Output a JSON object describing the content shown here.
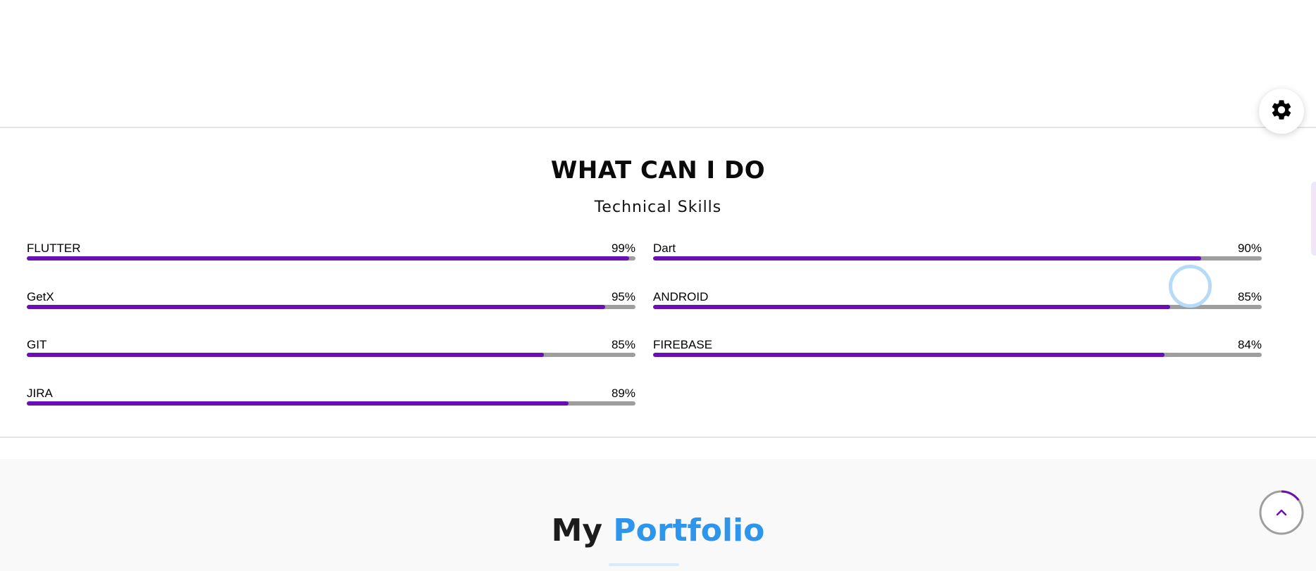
{
  "settings": {
    "icon": "gear-icon"
  },
  "skills": {
    "title": "WHAT CAN I DO",
    "subtitle": "Technical Skills",
    "colors": {
      "fill": "#6a0fb1",
      "track": "#9e9e9e"
    },
    "items": [
      {
        "name": "FLUTTER",
        "percent_label": "99%",
        "value": 99
      },
      {
        "name": "Dart",
        "percent_label": "90%",
        "value": 90
      },
      {
        "name": "GetX",
        "percent_label": "95%",
        "value": 95
      },
      {
        "name": "ANDROID",
        "percent_label": "85%",
        "value": 85
      },
      {
        "name": "GIT",
        "percent_label": "85%",
        "value": 85
      },
      {
        "name": "FIREBASE",
        "percent_label": "84%",
        "value": 84
      },
      {
        "name": "JIRA",
        "percent_label": "89%",
        "value": 89
      }
    ]
  },
  "portfolio": {
    "title_part1": "My",
    "title_part2": "Portfolio",
    "accent": "#2d96ec"
  },
  "scroll_top": {
    "icon": "chevron-up-icon",
    "progress": 0.15
  }
}
